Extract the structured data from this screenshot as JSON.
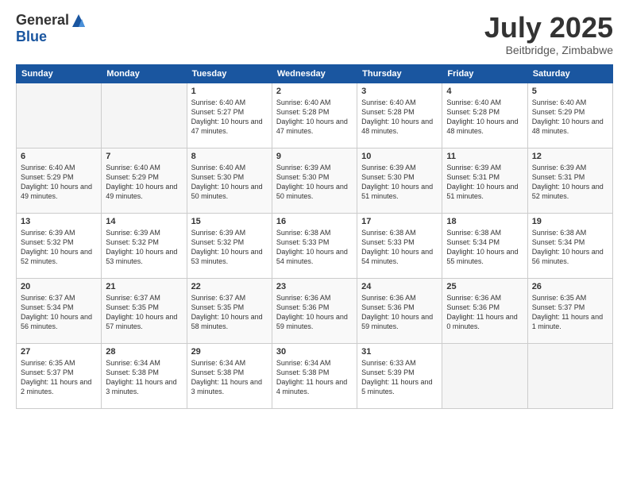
{
  "header": {
    "logo_general": "General",
    "logo_blue": "Blue",
    "month_title": "July 2025",
    "location": "Beitbridge, Zimbabwe"
  },
  "days_of_week": [
    "Sunday",
    "Monday",
    "Tuesday",
    "Wednesday",
    "Thursday",
    "Friday",
    "Saturday"
  ],
  "weeks": [
    [
      {
        "day": "",
        "info": ""
      },
      {
        "day": "",
        "info": ""
      },
      {
        "day": "1",
        "info": "Sunrise: 6:40 AM\nSunset: 5:27 PM\nDaylight: 10 hours and 47 minutes."
      },
      {
        "day": "2",
        "info": "Sunrise: 6:40 AM\nSunset: 5:28 PM\nDaylight: 10 hours and 47 minutes."
      },
      {
        "day": "3",
        "info": "Sunrise: 6:40 AM\nSunset: 5:28 PM\nDaylight: 10 hours and 48 minutes."
      },
      {
        "day": "4",
        "info": "Sunrise: 6:40 AM\nSunset: 5:28 PM\nDaylight: 10 hours and 48 minutes."
      },
      {
        "day": "5",
        "info": "Sunrise: 6:40 AM\nSunset: 5:29 PM\nDaylight: 10 hours and 48 minutes."
      }
    ],
    [
      {
        "day": "6",
        "info": "Sunrise: 6:40 AM\nSunset: 5:29 PM\nDaylight: 10 hours and 49 minutes."
      },
      {
        "day": "7",
        "info": "Sunrise: 6:40 AM\nSunset: 5:29 PM\nDaylight: 10 hours and 49 minutes."
      },
      {
        "day": "8",
        "info": "Sunrise: 6:40 AM\nSunset: 5:30 PM\nDaylight: 10 hours and 50 minutes."
      },
      {
        "day": "9",
        "info": "Sunrise: 6:39 AM\nSunset: 5:30 PM\nDaylight: 10 hours and 50 minutes."
      },
      {
        "day": "10",
        "info": "Sunrise: 6:39 AM\nSunset: 5:30 PM\nDaylight: 10 hours and 51 minutes."
      },
      {
        "day": "11",
        "info": "Sunrise: 6:39 AM\nSunset: 5:31 PM\nDaylight: 10 hours and 51 minutes."
      },
      {
        "day": "12",
        "info": "Sunrise: 6:39 AM\nSunset: 5:31 PM\nDaylight: 10 hours and 52 minutes."
      }
    ],
    [
      {
        "day": "13",
        "info": "Sunrise: 6:39 AM\nSunset: 5:32 PM\nDaylight: 10 hours and 52 minutes."
      },
      {
        "day": "14",
        "info": "Sunrise: 6:39 AM\nSunset: 5:32 PM\nDaylight: 10 hours and 53 minutes."
      },
      {
        "day": "15",
        "info": "Sunrise: 6:39 AM\nSunset: 5:32 PM\nDaylight: 10 hours and 53 minutes."
      },
      {
        "day": "16",
        "info": "Sunrise: 6:38 AM\nSunset: 5:33 PM\nDaylight: 10 hours and 54 minutes."
      },
      {
        "day": "17",
        "info": "Sunrise: 6:38 AM\nSunset: 5:33 PM\nDaylight: 10 hours and 54 minutes."
      },
      {
        "day": "18",
        "info": "Sunrise: 6:38 AM\nSunset: 5:34 PM\nDaylight: 10 hours and 55 minutes."
      },
      {
        "day": "19",
        "info": "Sunrise: 6:38 AM\nSunset: 5:34 PM\nDaylight: 10 hours and 56 minutes."
      }
    ],
    [
      {
        "day": "20",
        "info": "Sunrise: 6:37 AM\nSunset: 5:34 PM\nDaylight: 10 hours and 56 minutes."
      },
      {
        "day": "21",
        "info": "Sunrise: 6:37 AM\nSunset: 5:35 PM\nDaylight: 10 hours and 57 minutes."
      },
      {
        "day": "22",
        "info": "Sunrise: 6:37 AM\nSunset: 5:35 PM\nDaylight: 10 hours and 58 minutes."
      },
      {
        "day": "23",
        "info": "Sunrise: 6:36 AM\nSunset: 5:36 PM\nDaylight: 10 hours and 59 minutes."
      },
      {
        "day": "24",
        "info": "Sunrise: 6:36 AM\nSunset: 5:36 PM\nDaylight: 10 hours and 59 minutes."
      },
      {
        "day": "25",
        "info": "Sunrise: 6:36 AM\nSunset: 5:36 PM\nDaylight: 11 hours and 0 minutes."
      },
      {
        "day": "26",
        "info": "Sunrise: 6:35 AM\nSunset: 5:37 PM\nDaylight: 11 hours and 1 minute."
      }
    ],
    [
      {
        "day": "27",
        "info": "Sunrise: 6:35 AM\nSunset: 5:37 PM\nDaylight: 11 hours and 2 minutes."
      },
      {
        "day": "28",
        "info": "Sunrise: 6:34 AM\nSunset: 5:38 PM\nDaylight: 11 hours and 3 minutes."
      },
      {
        "day": "29",
        "info": "Sunrise: 6:34 AM\nSunset: 5:38 PM\nDaylight: 11 hours and 3 minutes."
      },
      {
        "day": "30",
        "info": "Sunrise: 6:34 AM\nSunset: 5:38 PM\nDaylight: 11 hours and 4 minutes."
      },
      {
        "day": "31",
        "info": "Sunrise: 6:33 AM\nSunset: 5:39 PM\nDaylight: 11 hours and 5 minutes."
      },
      {
        "day": "",
        "info": ""
      },
      {
        "day": "",
        "info": ""
      }
    ]
  ]
}
